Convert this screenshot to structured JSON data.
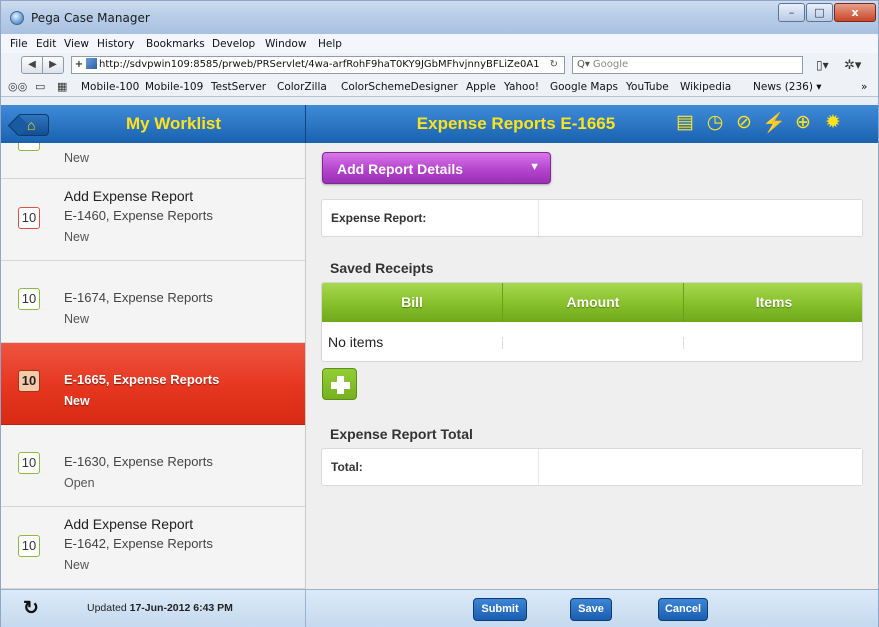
{
  "window": {
    "title": "Pega Case Manager",
    "controls": {
      "minimize": "–",
      "maximize": "□",
      "close": "x"
    }
  },
  "menu": [
    "File",
    "Edit",
    "View",
    "History",
    "Bookmarks",
    "Develop",
    "Window",
    "Help"
  ],
  "nav": {
    "back": "◀",
    "forward": "▶",
    "url": "http://sdvpwin109:8585/prweb/PRServlet/4wa-arfRohF9haT0KY9JGbMFhvjnnyBFLiZe0A1",
    "search_placeholder": "Google"
  },
  "bookmarks": [
    "Mobile-100",
    "Mobile-109",
    "TestServer",
    "ColorZilla",
    "ColorSchemeDesigner",
    "Apple",
    "Yahoo!",
    "Google Maps",
    "YouTube",
    "Wikipedia",
    "News (236) ▾"
  ],
  "header": {
    "worklist_title": "My Worklist",
    "case_title": "Expense Reports E-1665",
    "accent_color": "#ffe31a",
    "brand_color": "#1a62b0"
  },
  "worklist": [
    {
      "badge": "",
      "heading": "",
      "line1": "",
      "line2": "New",
      "partial": true
    },
    {
      "badge": "10",
      "badge_style": "red",
      "heading": "Add Expense Report",
      "line1": "E-1460, Expense Reports",
      "line2": "New"
    },
    {
      "badge": "10",
      "badge_style": "green",
      "heading": "",
      "line1": "E-1674, Expense Reports",
      "line2": "New"
    },
    {
      "badge": "10",
      "badge_style": "selected",
      "heading": "",
      "line1": "E-1665, Expense Reports",
      "line2": "New",
      "selected": true
    },
    {
      "badge": "10",
      "badge_style": "green",
      "heading": "",
      "line1": "E-1630, Expense Reports",
      "line2": "Open"
    },
    {
      "badge": "10",
      "badge_style": "green",
      "heading": "Add Expense Report",
      "line1": "E-1642, Expense Reports",
      "line2": "New"
    }
  ],
  "main": {
    "action_menu": "Add Report Details",
    "expense_report_label": "Expense Report:",
    "expense_report_value": "",
    "saved_receipts_title": "Saved Receipts",
    "receipts_columns": [
      "Bill",
      "Amount",
      "Items"
    ],
    "receipts_empty": "No items",
    "total_section_title": "Expense Report Total",
    "total_label": "Total:",
    "total_value": ""
  },
  "footer": {
    "updated_prefix": "Updated ",
    "updated_value": "17-Jun-2012 6:43 PM",
    "buttons": [
      "Submit",
      "Save",
      "Cancel"
    ]
  }
}
